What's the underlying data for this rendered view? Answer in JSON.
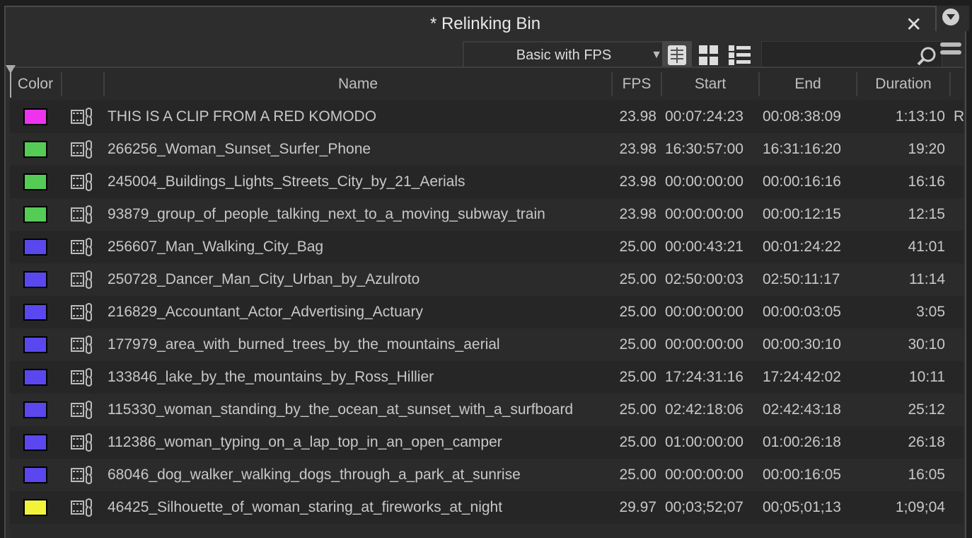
{
  "window": {
    "title": "* Relinking Bin",
    "close_icon": "close-icon",
    "menu_icon": "circle-chevron-down-icon"
  },
  "toolbar": {
    "preset": "Basic with FPS",
    "views": [
      "frame-view-icon",
      "script-view-icon",
      "list-view-icon"
    ],
    "active_view": "frame-view-icon",
    "search_value": "",
    "search_icon": "search-icon",
    "menu_icon": "hamburger-icon"
  },
  "columns": [
    "Color",
    "",
    "Name",
    "FPS",
    "Start",
    "End",
    "Duration"
  ],
  "rows": [
    {
      "color": "#ee33ee",
      "name": "THIS IS A CLIP FROM A RED KOMODO",
      "fps": "23.98",
      "start": "00:07:24:23",
      "end": "00:08:38:09",
      "duration": "1:13:10",
      "extra": "R"
    },
    {
      "color": "#55cc55",
      "name": "266256_Woman_Sunset_Surfer_Phone",
      "fps": "23.98",
      "start": "16:30:57:00",
      "end": "16:31:16:20",
      "duration": "19:20"
    },
    {
      "color": "#55cc55",
      "name": "245004_Buildings_Lights_Streets_City_by_21_Aerials",
      "fps": "23.98",
      "start": "00:00:00:00",
      "end": "00:00:16:16",
      "duration": "16:16"
    },
    {
      "color": "#55cc55",
      "name": "93879_group_of_people_talking_next_to_a_moving_subway_train",
      "fps": "23.98",
      "start": "00:00:00:00",
      "end": "00:00:12:15",
      "duration": "12:15"
    },
    {
      "color": "#5a48ee",
      "name": "256607_Man_Walking_City_Bag",
      "fps": "25.00",
      "start": "00:00:43:21",
      "end": "00:01:24:22",
      "duration": "41:01"
    },
    {
      "color": "#5a48ee",
      "name": "250728_Dancer_Man_City_Urban_by_Azulroto",
      "fps": "25.00",
      "start": "02:50:00:03",
      "end": "02:50:11:17",
      "duration": "11:14"
    },
    {
      "color": "#5a48ee",
      "name": "216829_Accountant_Actor_Advertising_Actuary",
      "fps": "25.00",
      "start": "00:00:00:00",
      "end": "00:00:03:05",
      "duration": "3:05"
    },
    {
      "color": "#5a48ee",
      "name": "177979_area_with_burned_trees_by_the_mountains_aerial",
      "fps": "25.00",
      "start": "00:00:00:00",
      "end": "00:00:30:10",
      "duration": "30:10"
    },
    {
      "color": "#5a48ee",
      "name": "133846_lake_by_the_mountains_by_Ross_Hillier",
      "fps": "25.00",
      "start": "17:24:31:16",
      "end": "17:24:42:02",
      "duration": "10:11"
    },
    {
      "color": "#5a48ee",
      "name": "115330_woman_standing_by_the_ocean_at_sunset_with_a_surfboard",
      "fps": "25.00",
      "start": "02:42:18:06",
      "end": "02:42:43:18",
      "duration": "25:12"
    },
    {
      "color": "#5a48ee",
      "name": "112386_woman_typing_on_a_lap_top_in_an_open_camper",
      "fps": "25.00",
      "start": "01:00:00:00",
      "end": "01:00:26:18",
      "duration": "26:18"
    },
    {
      "color": "#5a48ee",
      "name": "68046_dog_walker_walking_dogs_through_a_park_at_sunrise",
      "fps": "25.00",
      "start": "00:00:00:00",
      "end": "00:00:16:05",
      "duration": "16:05"
    },
    {
      "color": "#f2f23a",
      "name": "46425_Silhouette_of_woman_staring_at_fireworks_at_night",
      "fps": "29.97",
      "start": "00;03;52;07",
      "end": "00;05;01;13",
      "duration": "1;09;04"
    }
  ]
}
